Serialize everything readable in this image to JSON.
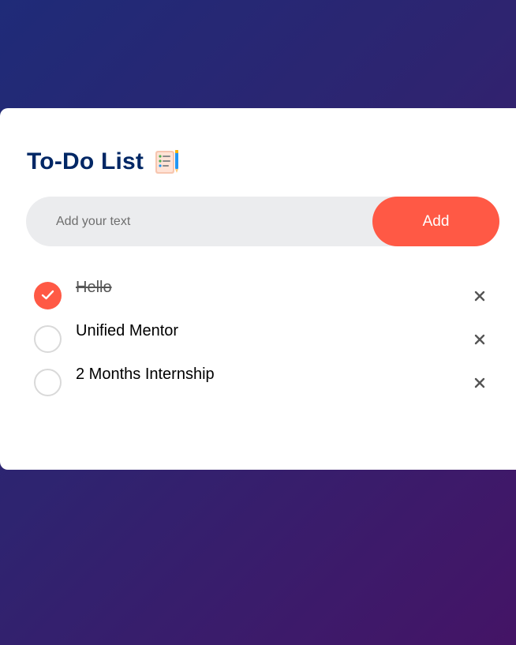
{
  "app": {
    "title": "To-Do List",
    "title_icon": "checklist-notepad-icon"
  },
  "input": {
    "placeholder": "Add your text",
    "value": ""
  },
  "add_button": {
    "label": "Add"
  },
  "tasks": [
    {
      "text": "Hello",
      "checked": true,
      "delete_icon": "close-icon"
    },
    {
      "text": "Unified Mentor",
      "checked": false,
      "delete_icon": "close-icon"
    },
    {
      "text": "2 Months Internship",
      "checked": false,
      "delete_icon": "close-icon"
    }
  ],
  "colors": {
    "accent": "#ff5945",
    "title": "#002765",
    "input_bg": "#ebecee",
    "card_bg": "#ffffff",
    "background_start": "#1f2b78",
    "background_end": "#441466"
  }
}
